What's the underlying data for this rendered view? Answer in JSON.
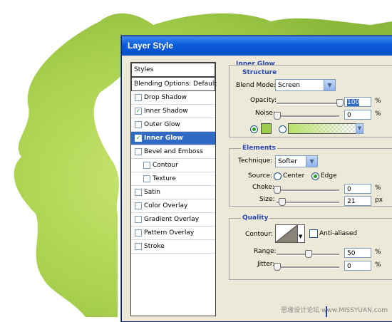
{
  "dialog": {
    "title": "Layer Style"
  },
  "styles_panel": {
    "header": "Styles",
    "blending_options": "Blending Options: Default",
    "items": [
      {
        "label": "Drop Shadow",
        "checked": false,
        "indent": false,
        "selected": false
      },
      {
        "label": "Inner Shadow",
        "checked": true,
        "indent": false,
        "selected": false
      },
      {
        "label": "Outer Glow",
        "checked": false,
        "indent": false,
        "selected": false
      },
      {
        "label": "Inner Glow",
        "checked": true,
        "indent": false,
        "selected": true
      },
      {
        "label": "Bevel and Emboss",
        "checked": false,
        "indent": false,
        "selected": false
      },
      {
        "label": "Contour",
        "checked": false,
        "indent": true,
        "selected": false
      },
      {
        "label": "Texture",
        "checked": false,
        "indent": true,
        "selected": false
      },
      {
        "label": "Satin",
        "checked": false,
        "indent": false,
        "selected": false
      },
      {
        "label": "Color Overlay",
        "checked": false,
        "indent": false,
        "selected": false
      },
      {
        "label": "Gradient Overlay",
        "checked": false,
        "indent": false,
        "selected": false
      },
      {
        "label": "Pattern Overlay",
        "checked": false,
        "indent": false,
        "selected": false
      },
      {
        "label": "Stroke",
        "checked": false,
        "indent": false,
        "selected": false
      }
    ]
  },
  "inner_glow": {
    "section_title": "Inner Glow",
    "structure": {
      "title": "Structure",
      "blend_mode_label": "Blend Mode:",
      "blend_mode_value": "Screen",
      "opacity_label": "Opacity:",
      "opacity_value": "100",
      "opacity_unit": "%",
      "opacity_level": 1.0,
      "noise_label": "Noise:",
      "noise_value": "0",
      "noise_unit": "%",
      "noise_level": 0.0,
      "color_swatch": "#9ccd4a",
      "gradient_start": "#b9e36a"
    },
    "elements": {
      "title": "Elements",
      "technique_label": "Technique:",
      "technique_value": "Softer",
      "source_label": "Source:",
      "source_center": "Center",
      "source_edge": "Edge",
      "choke_label": "Choke:",
      "choke_value": "0",
      "choke_unit": "%",
      "choke_level": 0.0,
      "size_label": "Size:",
      "size_value": "21",
      "size_unit": "px",
      "size_level": 0.08
    },
    "quality": {
      "title": "Quality",
      "contour_label": "Contour:",
      "anti_aliased_label": "Anti-aliased",
      "range_label": "Range:",
      "range_value": "50",
      "range_unit": "%",
      "range_level": 0.5,
      "jitter_label": "Jitter:",
      "jitter_value": "0",
      "jitter_unit": "%",
      "jitter_level": 0.0
    }
  },
  "watermark": "思缘设计论坛 www.MISSYUAN.com",
  "colors": {
    "accent": "#316ac5",
    "title_bar": "#0b5bd9",
    "blob_green": "#9ccd4a"
  }
}
